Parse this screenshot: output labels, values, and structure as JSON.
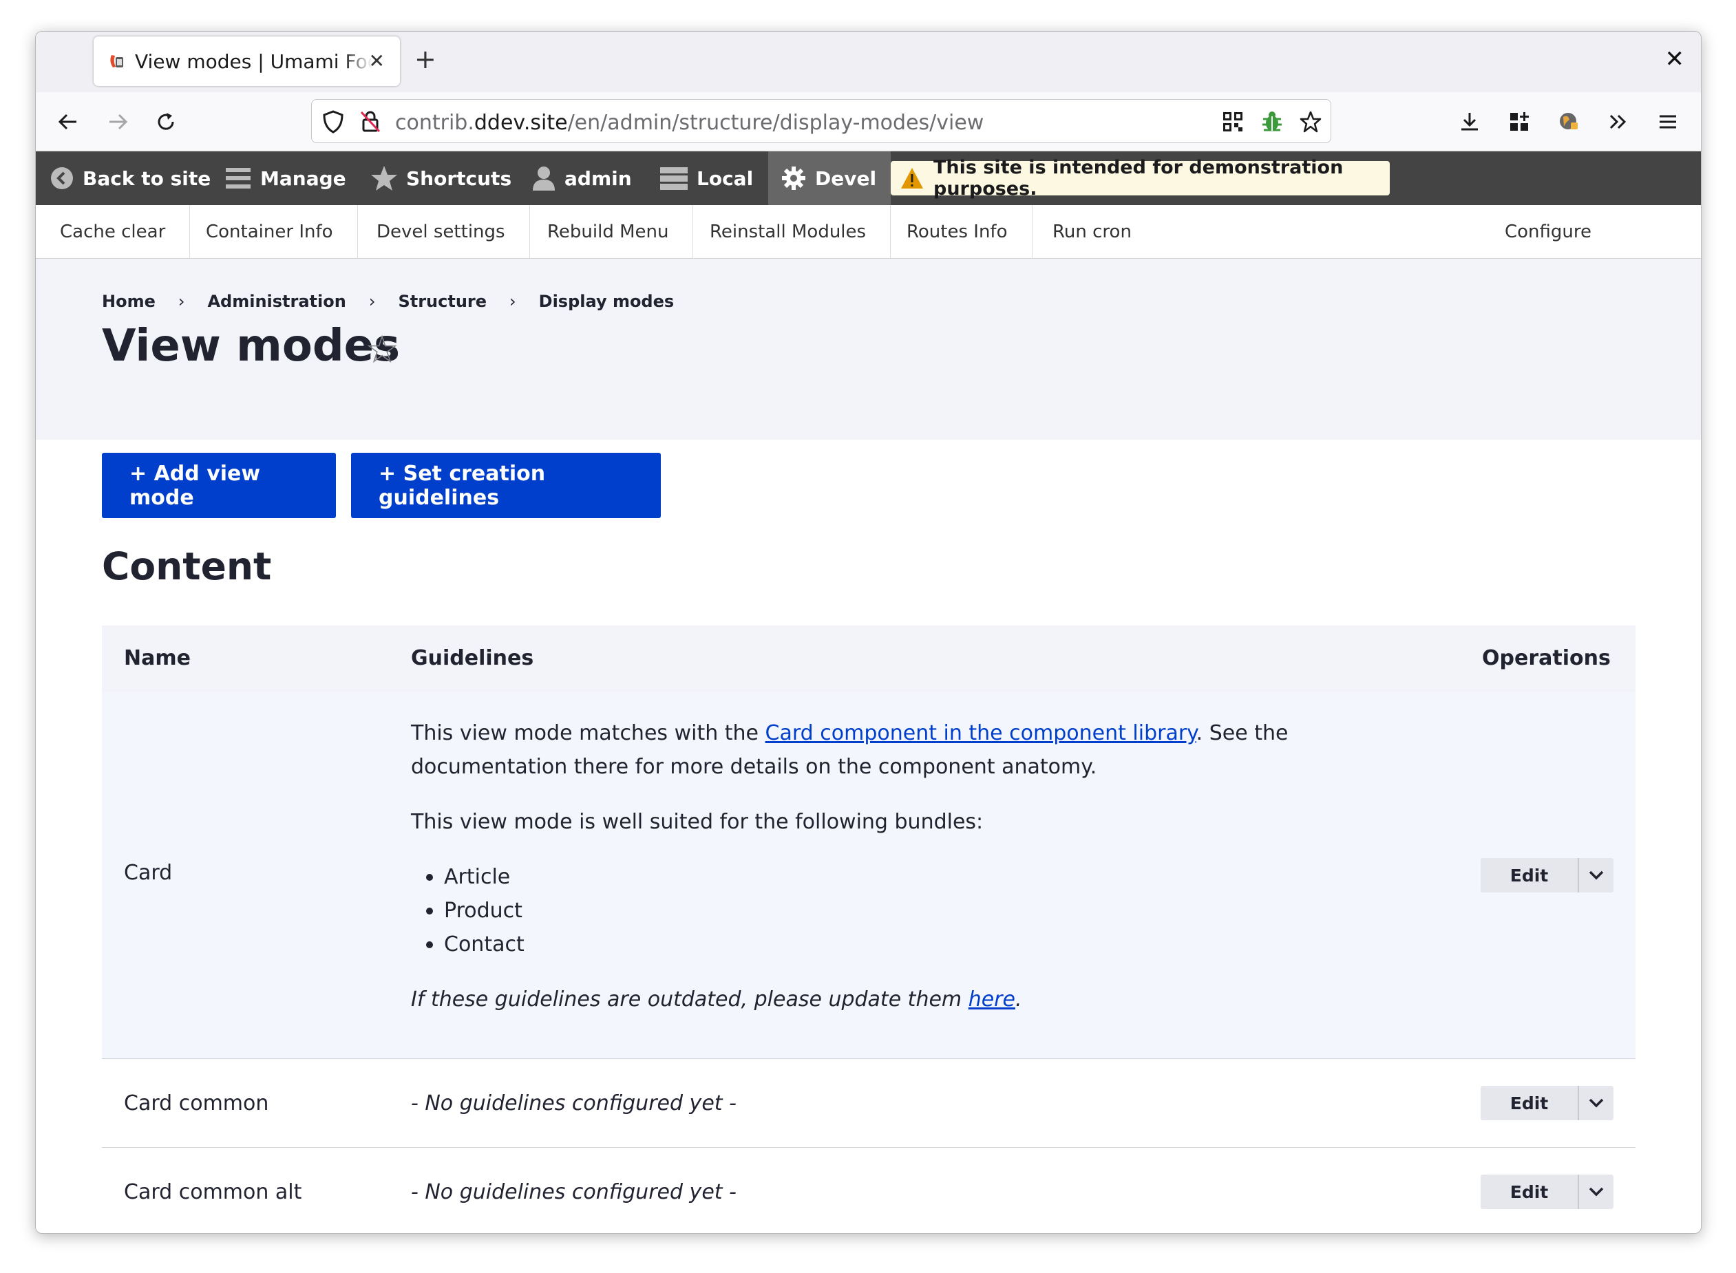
{
  "browser": {
    "tab_title": "View modes | Umami Food Magazine",
    "url_prefix": "contrib.",
    "url_domain": "ddev.site",
    "url_path": "/en/admin/structure/display-modes/view"
  },
  "toolbar": {
    "back_to_site": "Back to site",
    "manage": "Manage",
    "shortcuts": "Shortcuts",
    "user": "admin",
    "environment": "Local",
    "devel": "Devel",
    "notice": "This site is intended for demonstration purposes."
  },
  "devel_tray": {
    "items": [
      "Cache clear",
      "Container Info",
      "Devel settings",
      "Rebuild Menu",
      "Reinstall Modules",
      "Routes Info",
      "Run cron"
    ],
    "configure": "Configure"
  },
  "breadcrumb": [
    "Home",
    "Administration",
    "Structure",
    "Display modes"
  ],
  "page_title": "View modes",
  "actions": {
    "add_view_mode": "+ Add view mode",
    "set_guidelines": "+ Set creation guidelines"
  },
  "section_title": "Content",
  "table": {
    "headers": {
      "name": "Name",
      "guidelines": "Guidelines",
      "operations": "Operations"
    },
    "edit_label": "Edit",
    "rows": [
      {
        "name": "Card",
        "guide_intro_before": "This view mode matches with the ",
        "guide_link": "Card component in the component library",
        "guide_intro_after": ". See the documentation there for more details on the component anatomy.",
        "guide_bundles_intro": "This view mode is well suited for the following bundles:",
        "bundles": [
          "Article",
          "Product",
          "Contact"
        ],
        "guide_outdated_before": "If these guidelines are outdated, please update them ",
        "guide_outdated_link": "here",
        "guide_outdated_after": "."
      },
      {
        "name": "Card common",
        "guidelines": "- No guidelines configured yet -"
      },
      {
        "name": "Card common alt",
        "guidelines": "- No guidelines configured yet -"
      }
    ]
  },
  "colors": {
    "primary": "#003ecc",
    "toolbar_bg": "#444444",
    "header_bg": "#f3f4f9"
  }
}
